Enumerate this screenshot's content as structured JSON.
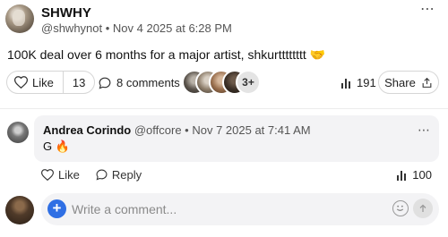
{
  "post": {
    "author": "SHWHY",
    "meta": "@shwhynot • Nov 4 2025 at 6:28 PM",
    "text": "100K deal over 6 months for a major artist, shkurtttttttt 🤝",
    "more_icon": "⋯"
  },
  "actions": {
    "like_label": "Like",
    "like_count": "13",
    "comments_label": "8 comments",
    "facepile_more": "3+",
    "views": "191",
    "share_label": "Share"
  },
  "comment": {
    "author": "Andrea Corindo",
    "meta": "@offcore • Nov 7 2025 at 7:41 AM",
    "text": "G 🔥",
    "more_icon": "⋯",
    "like_label": "Like",
    "reply_label": "Reply",
    "views": "100"
  },
  "composer": {
    "placeholder": "Write a comment...",
    "plus_icon": "+"
  },
  "colors": {
    "accent": "#2f6fe4",
    "bubble": "#f3f3f5"
  }
}
